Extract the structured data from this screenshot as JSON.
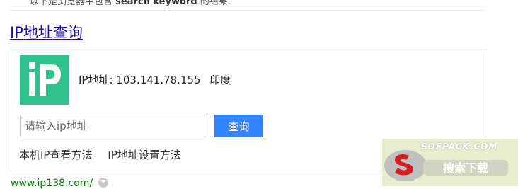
{
  "previous_result": {
    "snippet_text": "以下是浏览器中包含",
    "snippet_bold": "search keyword",
    "snippet_end": "的结果."
  },
  "result": {
    "title": "IP地址查询",
    "logo_text": "iP",
    "ip_label": "IP地址: 103.141.78.155",
    "location": "印度",
    "input_placeholder": "请输入ip地址",
    "query_button": "查询",
    "links": [
      "本机IP查看方法",
      "IP地址设置方法"
    ],
    "url": "www.ip138.com/"
  },
  "watermark": {
    "text": "SOFPACK.COM"
  },
  "colors": {
    "title_link": "#1a0dab",
    "logo_bg": "#30c28c",
    "button_bg": "#3385ff",
    "url": "#008000"
  }
}
